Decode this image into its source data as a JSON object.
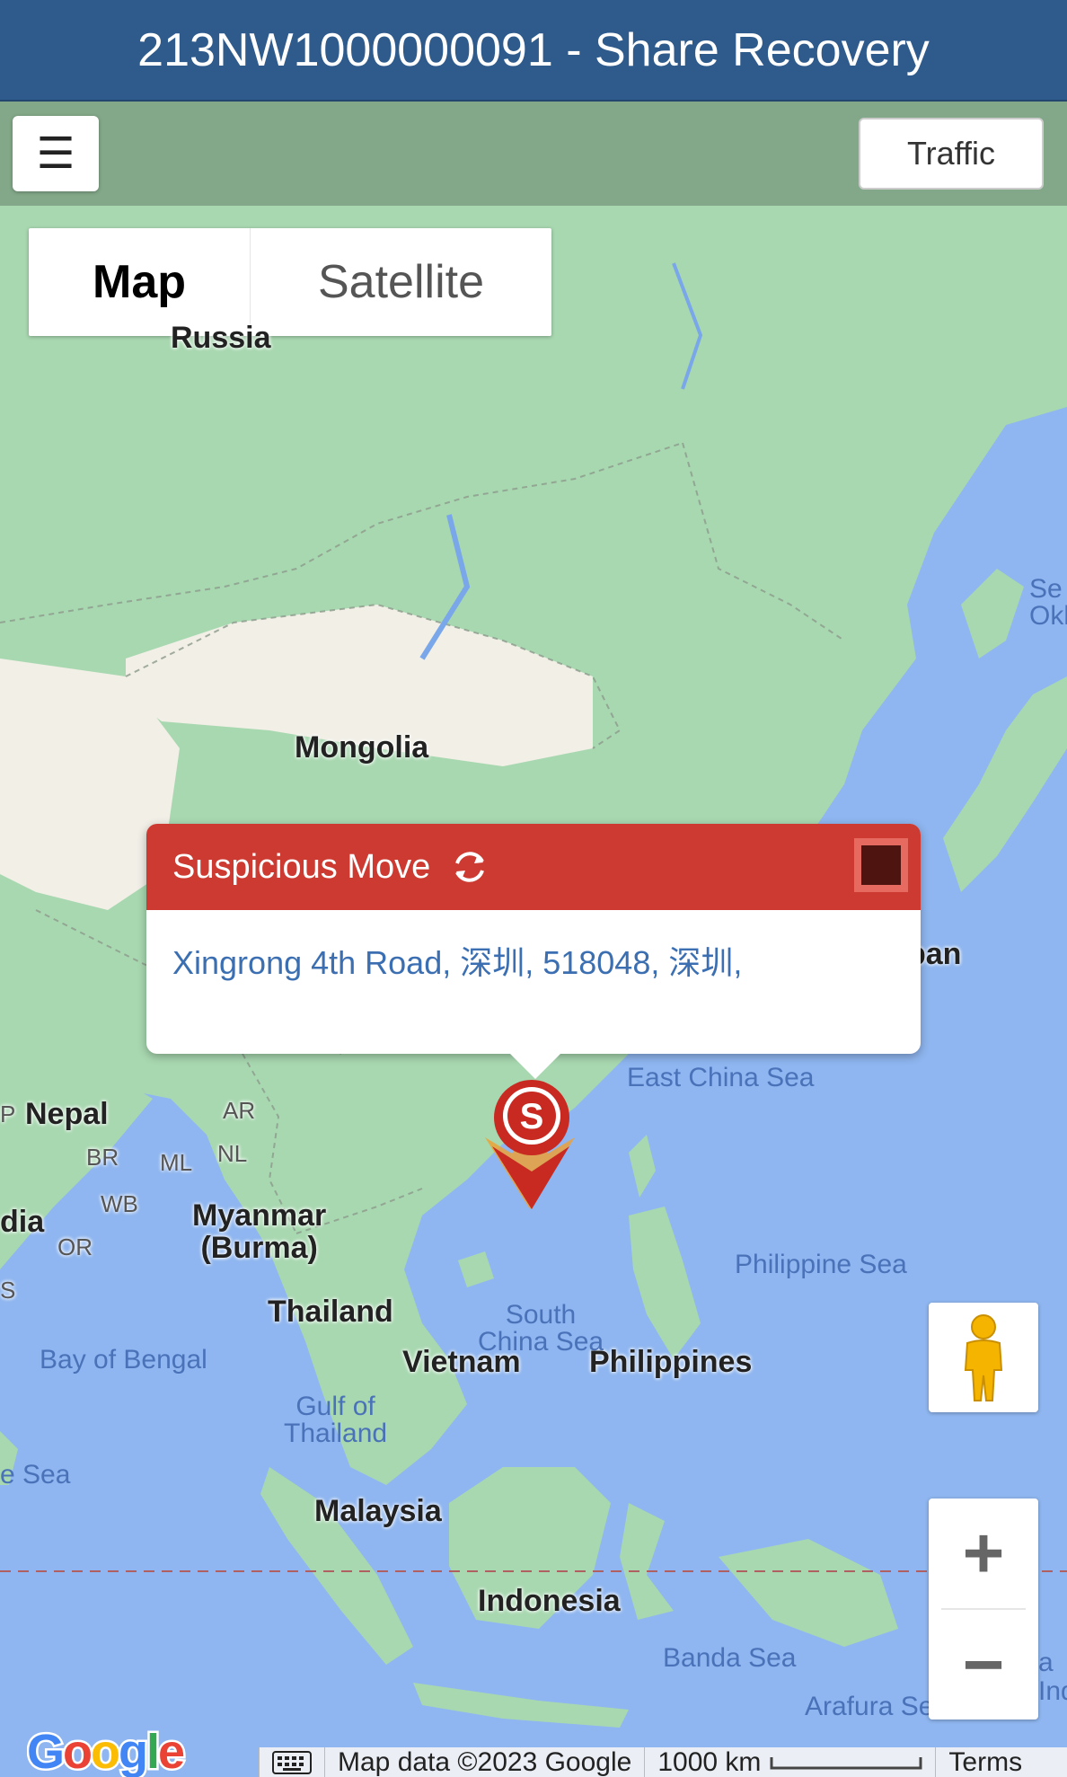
{
  "header": {
    "title": "213NW1000000091 - Share Recovery"
  },
  "controls": {
    "menu_icon": "hamburger-icon",
    "menu_glyph": "☰",
    "traffic_label": "Traffic",
    "map_type": {
      "map": "Map",
      "satellite": "Satellite",
      "selected": "Map"
    },
    "zoom_in": "+",
    "zoom_out": "−"
  },
  "map": {
    "labels": {
      "russia": "Russia",
      "mongolia": "Mongolia",
      "japan": "pan",
      "sea_of_okhotsk": "Se\nOkl",
      "nepal": "Nepal",
      "nepal_p": "P",
      "india": "dia",
      "ar": "AR",
      "br": "BR",
      "ml": "ML",
      "nl": "NL",
      "wb": "WB",
      "or": "OR",
      "s": "S",
      "myanmar": "Myanmar\n(Burma)",
      "thailand": "Thailand",
      "vietnam": "Vietnam",
      "philippines": "Philippines",
      "malaysia": "Malaysia",
      "indonesia": "Indonesia",
      "east_china_sea": "East China Sea",
      "philippine_sea": "Philippine Sea",
      "south_china_sea": "South\nChina Sea",
      "bay_of_bengal": "Bay of Bengal",
      "gulf_of_thailand": "Gulf of\nThailand",
      "e_sea": "e Sea",
      "banda_sea": "Banda Sea",
      "arafura_sea": "Arafura Se",
      "a_ind": "a\nInd"
    },
    "colors": {
      "land": "#a8d8b0",
      "desert": "#f1efe6",
      "water": "#8fb6f0",
      "header": "#2f5a8c",
      "alert": "#cc3a31"
    }
  },
  "popup": {
    "title": "Suspicious Move",
    "refresh_icon": "refresh-icon",
    "close_icon": "close-square-icon",
    "address": "Xingrong 4th Road, 深圳, 518048, 深圳,"
  },
  "marker": {
    "letter": "S"
  },
  "footer": {
    "logo": "Google",
    "keyboard_icon": "keyboard-icon",
    "attribution": "Map data ©2023 Google",
    "scale": "1000 km",
    "terms": "Terms"
  }
}
